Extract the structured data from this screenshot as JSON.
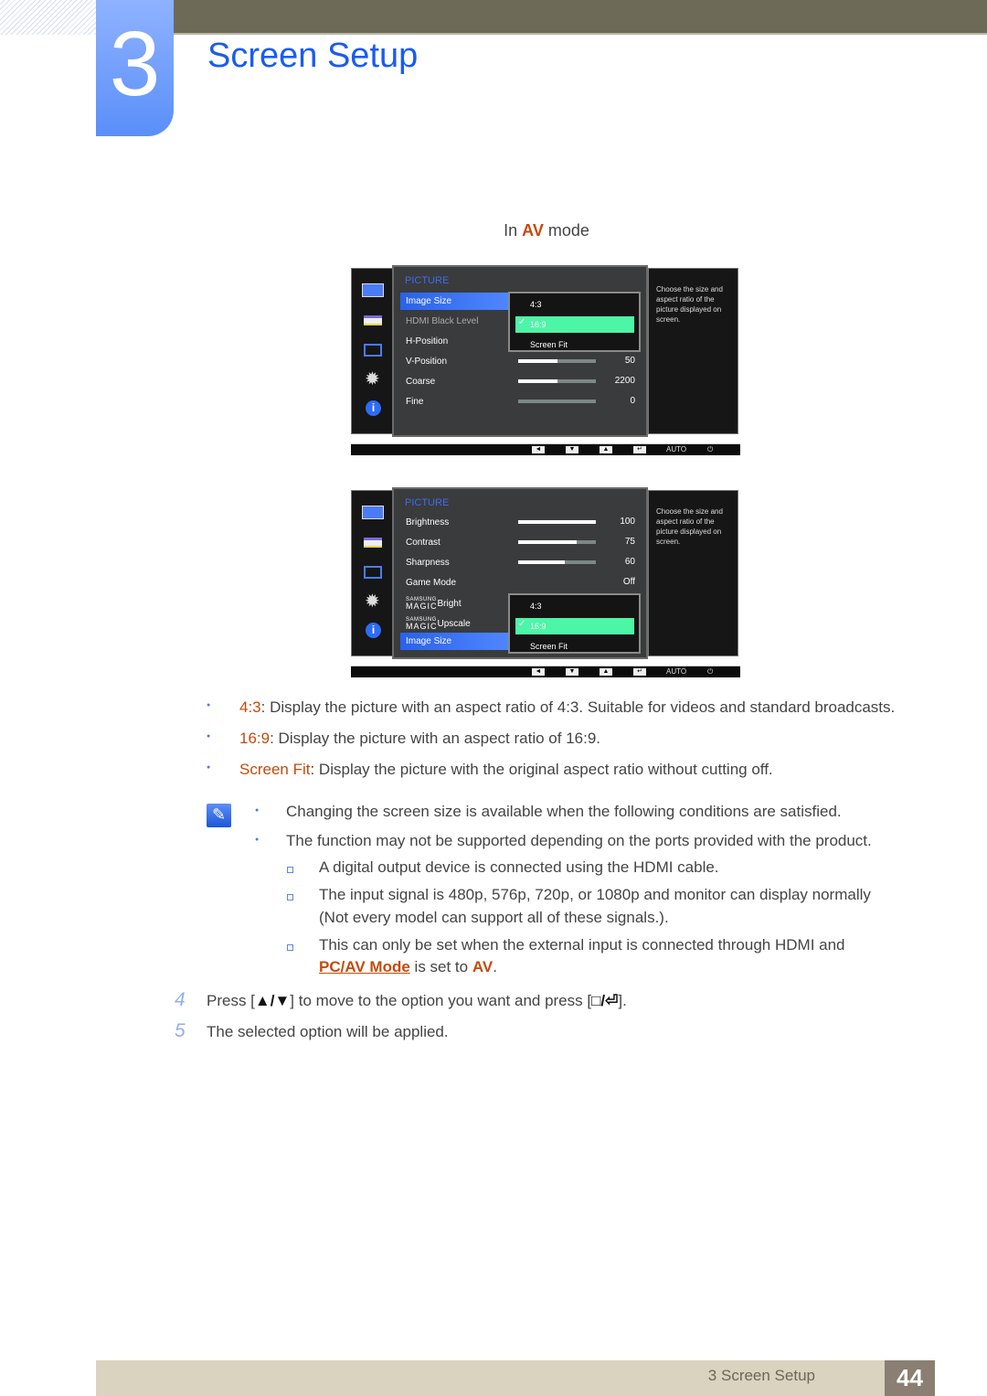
{
  "header": {
    "chapter_number": "3",
    "title": "Screen Setup"
  },
  "mode_caption": {
    "prefix": "In ",
    "mode": "AV",
    "suffix": " mode"
  },
  "panels": [
    {
      "header": "PICTURE",
      "rows": [
        {
          "label": "Image Size",
          "state": "selected"
        },
        {
          "label": "HDMI Black Level",
          "state": "disabled"
        },
        {
          "label": "H-Position"
        },
        {
          "label": "V-Position",
          "value": "50",
          "fill": 0.5
        },
        {
          "label": "Coarse",
          "value": "2200",
          "fill": 0.5
        },
        {
          "label": "Fine",
          "value": "0",
          "fill": 0
        }
      ],
      "popup": {
        "options": [
          "4:3",
          "16:9",
          "Screen Fit"
        ],
        "checked": 1
      },
      "help": "Choose the size and aspect ratio of the picture displayed on screen.",
      "buttons": [
        "◄",
        "▼",
        "▲",
        "↵",
        "AUTO",
        "⏻"
      ]
    },
    {
      "header": "PICTURE",
      "rows": [
        {
          "label": "Brightness",
          "value": "100",
          "fill": 1.0
        },
        {
          "label": "Contrast",
          "value": "75",
          "fill": 0.75
        },
        {
          "label": "Sharpness",
          "value": "60",
          "fill": 0.6
        },
        {
          "label": "Game Mode",
          "value": "Off"
        },
        {
          "brand": "SAMSUNG",
          "magic": "MAGIC",
          "label": "Bright"
        },
        {
          "brand": "SAMSUNG",
          "magic": "MAGIC",
          "label": "Upscale"
        },
        {
          "label": "Image Size",
          "state": "selected"
        }
      ],
      "popup": {
        "options": [
          "4:3",
          "16:9",
          "Screen Fit"
        ],
        "checked": 1
      },
      "help": "Choose the size and aspect ratio of the picture displayed on screen.",
      "buttons": [
        "◄",
        "▼",
        "▲",
        "↵",
        "AUTO",
        "⏻"
      ]
    }
  ],
  "options_list": [
    {
      "term": "4:3",
      "text": ": Display the picture with an aspect ratio of 4:3. Suitable for videos and standard broadcasts."
    },
    {
      "term": "16:9",
      "text": ": Display the picture with an aspect ratio of 16:9."
    },
    {
      "term": "Screen Fit",
      "text": ": Display the picture with the original aspect ratio without cutting off."
    }
  ],
  "note": {
    "bullets": [
      "Changing the screen size is available when the following conditions are satisfied.",
      "The function may not be supported depending on the ports provided with the product."
    ],
    "sub": [
      "A digital output device is connected using the HDMI cable.",
      "The input signal is 480p, 576p, 720p, or 1080p and monitor can display normally",
      "(Not every model can support all of these signals.).",
      "This can only be set when the external input is connected through HDMI and"
    ],
    "last_link": "PC/AV Mode",
    "last_mid": " is set to ",
    "last_val": "AV",
    "last_end": "."
  },
  "steps": [
    {
      "num": "4",
      "pre": "Press [",
      "keys": "▲/▼",
      "mid": "] to move to the option you want and press [",
      "keys2": "□/⏎",
      "post": "]."
    },
    {
      "num": "5",
      "text": "The selected option will be applied."
    }
  ],
  "footer": {
    "section": "3 Screen Setup",
    "page": "44"
  },
  "colors": {
    "accent_blue": "#1a5cf0",
    "term_orange": "#c64a0a",
    "selected_option": "#4df5a6"
  }
}
